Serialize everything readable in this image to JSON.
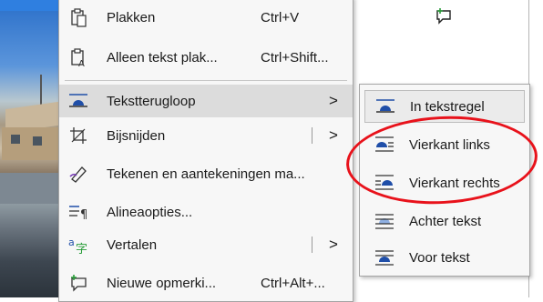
{
  "colors": {
    "annotation": "#e8121b",
    "menu_bg": "#f7f7f7",
    "highlight": "#dcdcdc",
    "icon_accent": "#1f4ea8"
  },
  "context_menu": {
    "items": [
      {
        "label": "Plakken",
        "shortcut": "Ctrl+V",
        "icon": "paste-icon"
      },
      {
        "label": "Alleen tekst plak...",
        "shortcut": "Ctrl+Shift...",
        "icon": "paste-text-only-icon"
      },
      {
        "label": "Tekstterugloop",
        "arrow": ">",
        "icon": "text-wrap-icon",
        "highlighted": true
      },
      {
        "label": "Bijsnijden",
        "arrow": ">",
        "icon": "crop-icon"
      },
      {
        "label": "Tekenen en aantekeningen ma...",
        "icon": "ink-pen-icon"
      },
      {
        "label": "Alineaopties...",
        "icon": "paragraph-icon"
      },
      {
        "label": "Vertalen",
        "arrow": ">",
        "icon": "translate-icon"
      },
      {
        "label": "Nieuwe opmerki...",
        "shortcut": "Ctrl+Alt+...",
        "icon": "new-comment-icon"
      }
    ]
  },
  "submenu": {
    "items": [
      {
        "label": "In tekstregel",
        "icon": "inline-wrap-icon",
        "selected": true
      },
      {
        "label": "Vierkant links",
        "icon": "square-left-wrap-icon"
      },
      {
        "label": "Vierkant rechts",
        "icon": "square-right-wrap-icon"
      },
      {
        "label": "Achter tekst",
        "icon": "behind-text-icon"
      },
      {
        "label": "Voor tekst",
        "icon": "in-front-text-icon"
      }
    ]
  }
}
